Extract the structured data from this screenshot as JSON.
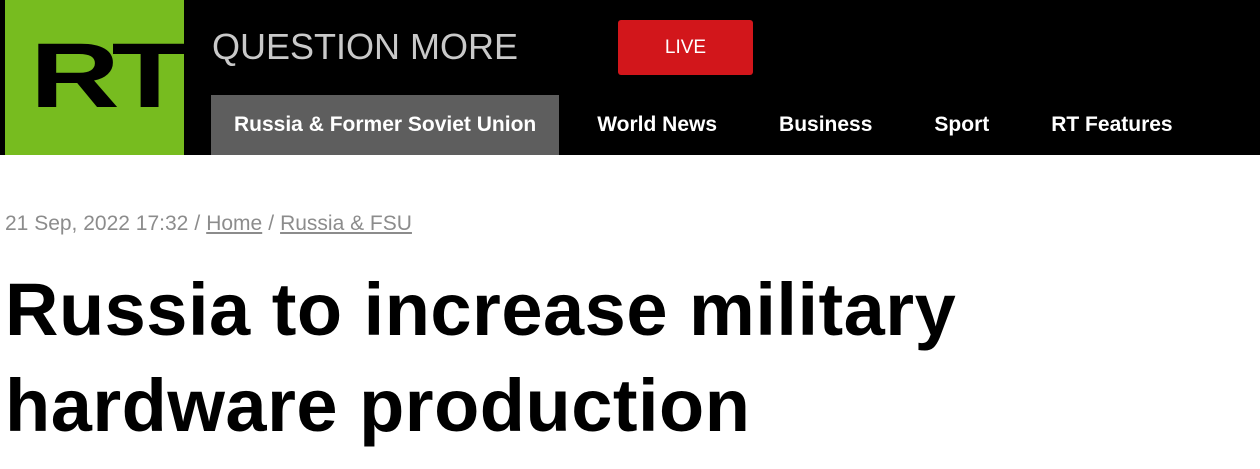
{
  "header": {
    "logo_text": "RT",
    "tagline": "QUESTION MORE",
    "live_label": "LIVE",
    "colors": {
      "logo_bg": "#77bc1f",
      "live_bg": "#d2161b",
      "header_bg": "#000000",
      "active_nav_bg": "#5e5e5e"
    }
  },
  "nav": {
    "items": [
      {
        "label": "Russia & Former Soviet Union",
        "active": true
      },
      {
        "label": "World News",
        "active": false
      },
      {
        "label": "Business",
        "active": false
      },
      {
        "label": "Sport",
        "active": false
      },
      {
        "label": "RT Features",
        "active": false
      }
    ]
  },
  "article": {
    "date": "21 Sep, 2022 17:32",
    "separator": "/",
    "breadcrumb": [
      "Home",
      "Russia & FSU"
    ],
    "headline": "Russia to increase military hardware production"
  }
}
